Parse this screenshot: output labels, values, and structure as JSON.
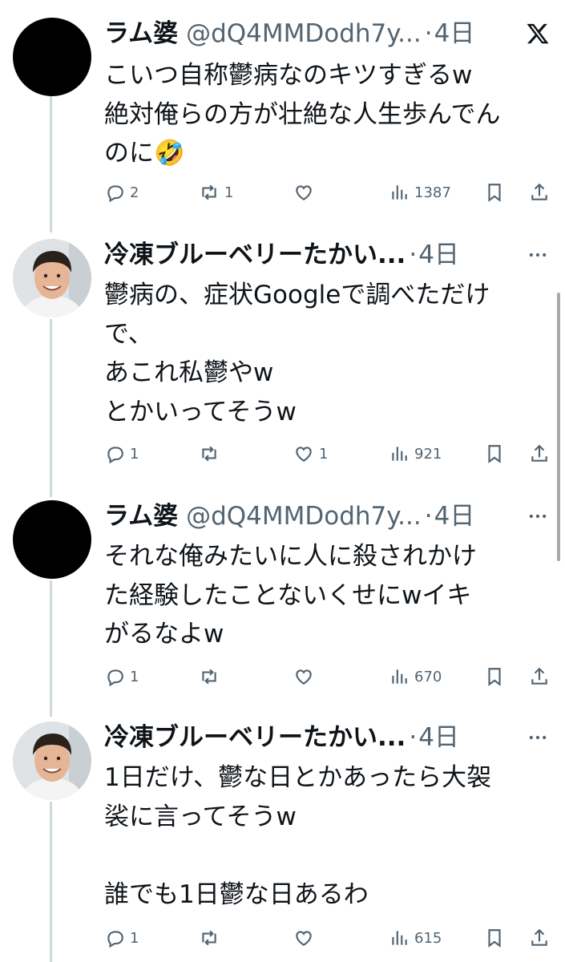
{
  "tweets": [
    {
      "name": "ラム婆",
      "handle": "@dQ4MMDodh7y...",
      "time": "4日",
      "avatar": "black-circle",
      "corner_icon": "x-logo-icon",
      "lines": [
        "こいつ自称鬱病なのキツすぎるw",
        "絶対俺らの方が壮絶な人生歩んでん",
        "のに🤣"
      ],
      "replies": "2",
      "reposts": "1",
      "likes": "",
      "views": "1387"
    },
    {
      "name": "冷凍ブルーベリーたかい...",
      "handle": "",
      "time": "4日",
      "avatar": "photo",
      "corner_icon": "more-icon",
      "lines": [
        "鬱病の、症状Googleで調べただけ",
        "で、",
        "あこれ私鬱やw",
        "とかいってそうw"
      ],
      "replies": "1",
      "reposts": "",
      "likes": "1",
      "views": "921"
    },
    {
      "name": "ラム婆",
      "handle": "@dQ4MMDodh7y...",
      "time": "4日",
      "avatar": "black-circle",
      "corner_icon": "more-icon",
      "lines": [
        "それな俺みたいに人に殺されかけ",
        "た経験したことないくせにwイキ",
        "がるなよw"
      ],
      "replies": "1",
      "reposts": "",
      "likes": "",
      "views": "670"
    },
    {
      "name": "冷凍ブルーベリーたかい...",
      "handle": "",
      "time": "4日",
      "avatar": "photo",
      "corner_icon": "more-icon",
      "lines": [
        "1日だけ、鬱な日とかあったら大袈",
        "裟に言ってそうw",
        "",
        "誰でも1日鬱な日あるわ"
      ],
      "replies": "1",
      "reposts": "",
      "likes": "",
      "views": "615"
    }
  ],
  "colors": {
    "text": "#0f1419",
    "secondary": "#536471",
    "thread_line": "#cfd9de"
  }
}
